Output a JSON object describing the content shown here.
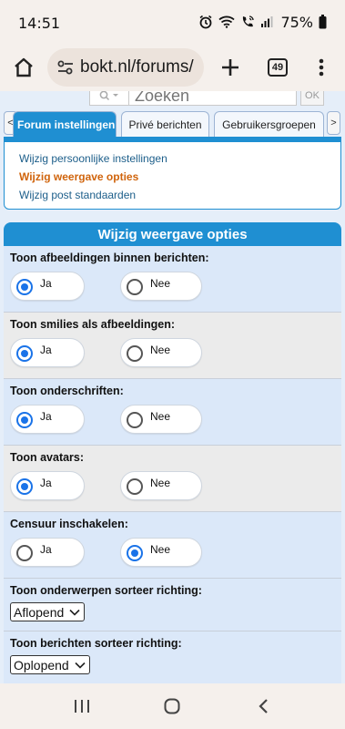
{
  "status": {
    "time": "14:51",
    "battery": "75%"
  },
  "browser": {
    "url": "bokt.nl/forums/",
    "tab_count": "49"
  },
  "search": {
    "placeholder": "Zoeken",
    "ok_label": "OK"
  },
  "tabs": {
    "prev": "<",
    "next": ">",
    "items": [
      {
        "label": "Forum instellingen",
        "active": true
      },
      {
        "label": "Privé berichten",
        "active": false
      },
      {
        "label": "Gebruikersgroepen",
        "active": false
      }
    ]
  },
  "submenu": {
    "items": [
      {
        "label": "Wijzig persoonlijke instellingen",
        "current": false
      },
      {
        "label": "Wijzig weergave opties",
        "current": true
      },
      {
        "label": "Wijzig post standaarden",
        "current": false
      }
    ]
  },
  "panel": {
    "title": "Wijzig weergave opties",
    "options": [
      {
        "label": "Toon afbeeldingen binnen berichten:",
        "yes": "Ja",
        "no": "Nee",
        "selected": "yes"
      },
      {
        "label": "Toon smilies als afbeeldingen:",
        "yes": "Ja",
        "no": "Nee",
        "selected": "yes"
      },
      {
        "label": "Toon onderschriften:",
        "yes": "Ja",
        "no": "Nee",
        "selected": "yes"
      },
      {
        "label": "Toon avatars:",
        "yes": "Ja",
        "no": "Nee",
        "selected": "yes"
      },
      {
        "label": "Censuur inschakelen:",
        "yes": "Ja",
        "no": "Nee",
        "selected": "no"
      }
    ],
    "sort_topics": {
      "label": "Toon onderwerpen sorteer richting:",
      "value": "Aflopend"
    },
    "sort_posts": {
      "label": "Toon berichten sorteer richting:",
      "value": "Oplopend"
    }
  },
  "colors": {
    "accent": "#1f8fd2",
    "current_link": "#d0640c",
    "radio_on": "#1a73e8"
  }
}
